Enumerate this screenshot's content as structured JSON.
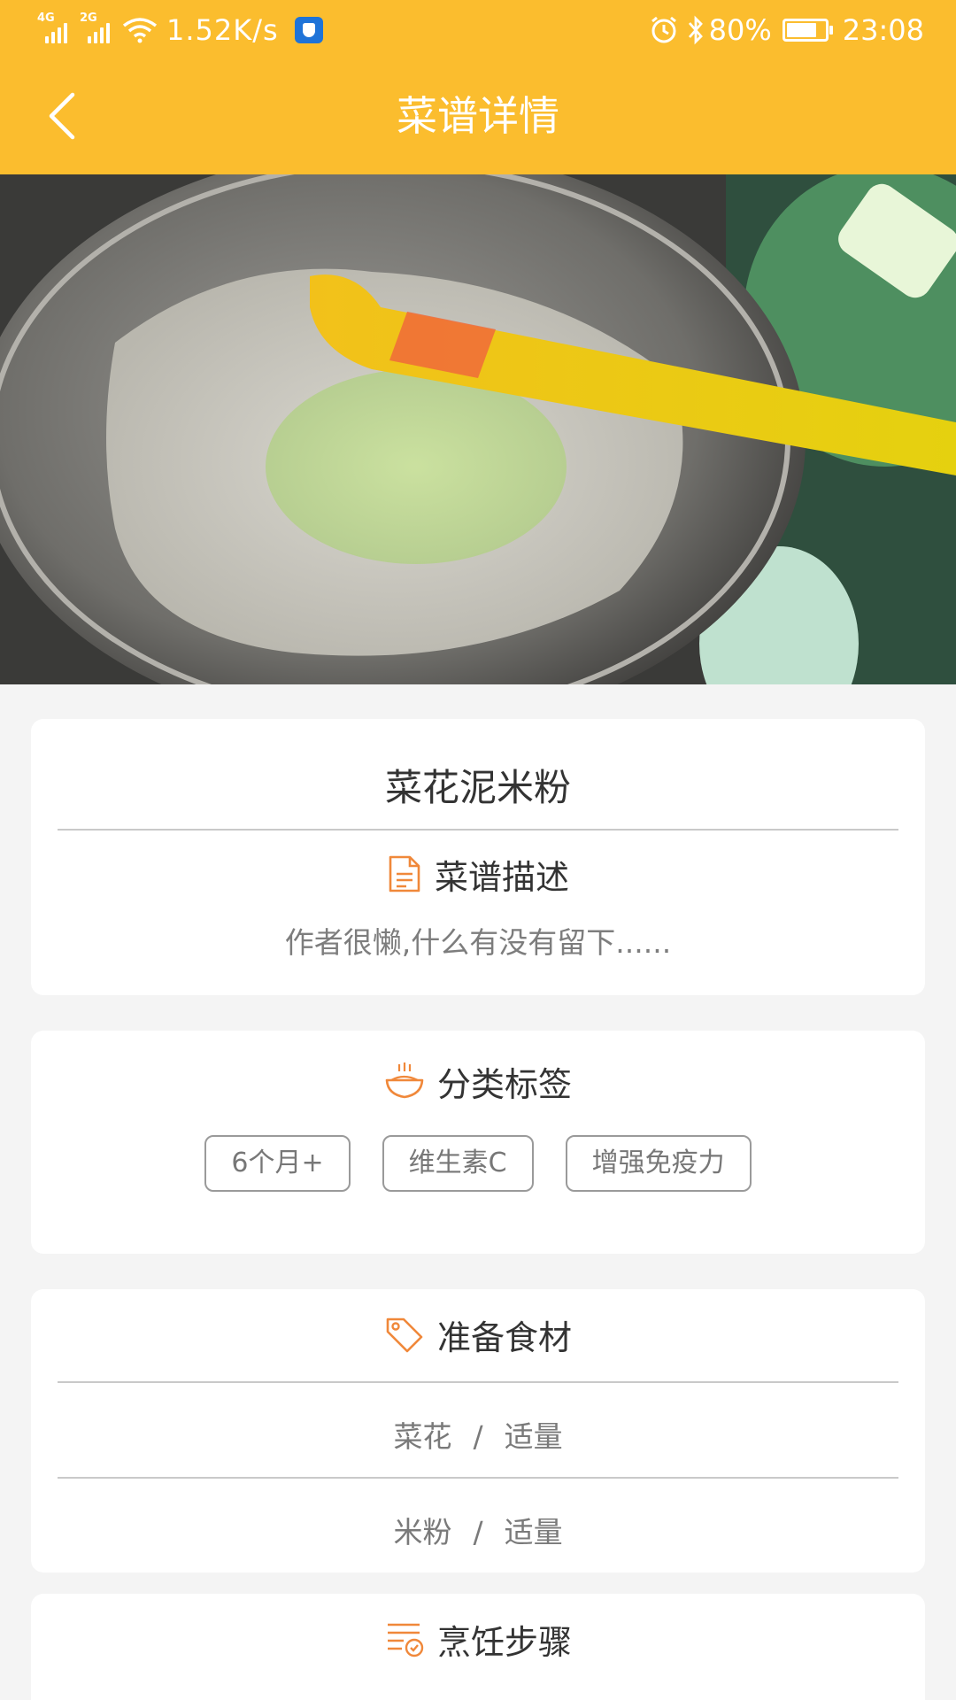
{
  "status_bar": {
    "network_1": "4G",
    "network_2": "2G",
    "speed": "1.52K/s",
    "battery_text": "80%",
    "battery_level": 0.8,
    "time": "23:08"
  },
  "header": {
    "title": "菜谱详情",
    "back_icon": "chevron-left-icon"
  },
  "recipe": {
    "name": "菜花泥米粉",
    "description_section": {
      "icon": "document-icon",
      "title": "菜谱描述",
      "text": "作者很懒,什么有没有留下......"
    },
    "tags_section": {
      "icon": "bowl-icon",
      "title": "分类标签",
      "tags": [
        "6个月+",
        "维生素C",
        "增强免疫力"
      ]
    },
    "ingredients_section": {
      "icon": "tag-icon",
      "title": "准备食材",
      "items": [
        {
          "name": "菜花",
          "separator": "/",
          "amount": "适量"
        },
        {
          "name": "米粉",
          "separator": "/",
          "amount": "适量"
        }
      ]
    },
    "steps_section": {
      "icon": "checklist-icon",
      "title": "烹饪步骤"
    }
  },
  "colors": {
    "primary": "#fbbd2e",
    "icon_orange": "#f0883a",
    "background": "#f4f4f4"
  }
}
